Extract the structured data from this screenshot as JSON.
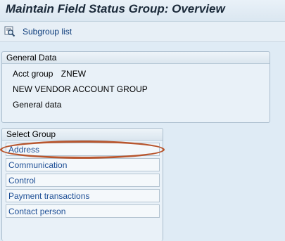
{
  "title": "Maintain Field Status Group: Overview",
  "toolbar": {
    "subgroup_list": {
      "label": "Subgroup list",
      "icon": "search-magnifier-icon"
    }
  },
  "general_data": {
    "header": "General Data",
    "acct_group_label": "Acct group",
    "acct_group_value": "ZNEW",
    "description": "NEW VENDOR ACCOUNT GROUP",
    "subtitle": "General data"
  },
  "select_group": {
    "header": "Select Group",
    "items": [
      {
        "label": "Address"
      },
      {
        "label": "Communication"
      },
      {
        "label": "Control"
      },
      {
        "label": "Payment transactions"
      },
      {
        "label": "Contact person"
      }
    ]
  },
  "colors": {
    "link": "#1e4f96",
    "highlight": "#b8562e",
    "background": "#dfebf5"
  }
}
